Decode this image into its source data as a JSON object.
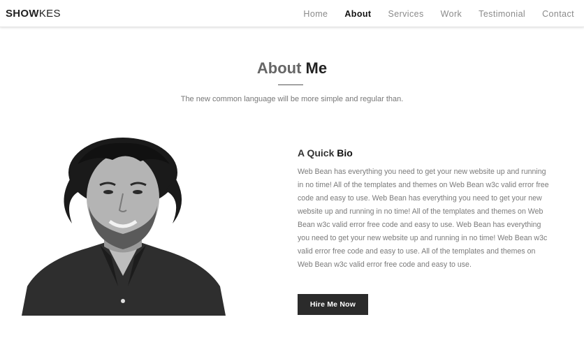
{
  "brand": {
    "bold": "SHOW",
    "light": "KES"
  },
  "nav": {
    "items": [
      {
        "label": "Home",
        "active": false
      },
      {
        "label": "About",
        "active": true
      },
      {
        "label": "Services",
        "active": false
      },
      {
        "label": "Work",
        "active": false
      },
      {
        "label": "Testimonial",
        "active": false
      },
      {
        "label": "Contact",
        "active": false
      }
    ]
  },
  "about": {
    "title_light": "About ",
    "title_bold": "Me",
    "subtitle": "The new common language will be more simple and regular than."
  },
  "bio": {
    "heading_light": "A Quick ",
    "heading_bold": "Bio",
    "text": "Web Bean has everything you need to get your new website up and running in no time! All of the templates and themes on Web Bean w3c valid error free code and easy to use. Web Bean has everything you need to get your new website up and running in no time! All of the templates and themes on Web Bean w3c valid error free code and easy to use. Web Bean has everything you need to get your new website up and running in no time! Web Bean w3c valid error free code and easy to use. All of the templates and themes on Web Bean w3c valid error free code and easy to use.",
    "button_label": "Hire Me Now"
  },
  "colors": {
    "accent_dark": "#2b2b2b",
    "text_muted": "#7a7a7a",
    "nav_inactive": "#8a8a8a"
  }
}
